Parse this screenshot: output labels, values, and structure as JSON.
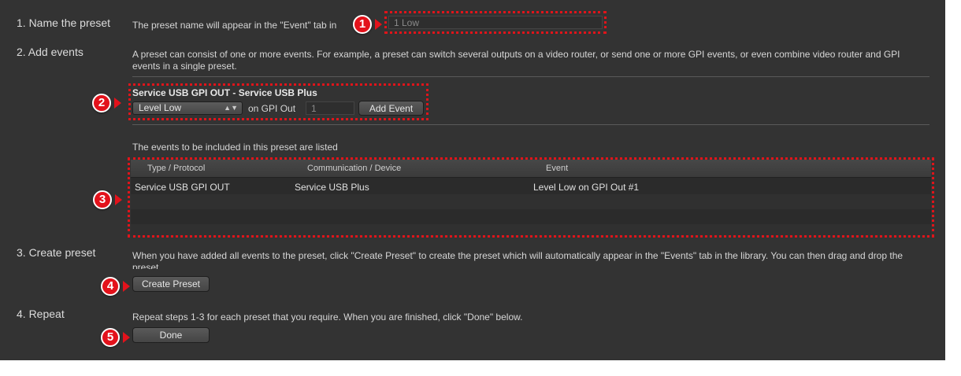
{
  "steps": {
    "name": "1. Name the preset",
    "add": "2. Add events",
    "create": "3. Create preset",
    "repeat": "4. Repeat"
  },
  "name_section": {
    "hint": "The preset name will appear in the \"Event\" tab in",
    "preset_name_value": "1 Low"
  },
  "add_section": {
    "description": "A preset can consist of one or more events. For example, a preset can switch several outputs on a video router, or send one or more GPI events, or even combine video router and GPI events in a single preset.",
    "device_title": "Service USB GPI OUT - Service USB Plus",
    "level_select": "Level Low",
    "on_gpi_label": "on GPI Out",
    "gpi_out_value": "1",
    "add_event_label": "Add Event",
    "events_listed": "The events to be included in this preset are listed"
  },
  "table": {
    "headers": [
      "Type / Protocol",
      "Communication / Device",
      "Event"
    ],
    "rows": [
      [
        "Service USB GPI OUT",
        "Service USB Plus",
        "Level Low on GPI Out #1"
      ]
    ]
  },
  "create_section": {
    "description": "When you have added all events to the preset, click \"Create Preset\" to create the preset which will automatically appear in the \"Events\" tab in the library. You can then drag and drop the preset",
    "create_button": "Create Preset"
  },
  "repeat_section": {
    "description": "Repeat steps 1-3 for each preset that you require. When you are finished, click \"Done\" below.",
    "done_button": "Done"
  },
  "badges": [
    "1",
    "2",
    "3",
    "4",
    "5"
  ],
  "colors": {
    "panel": "#333333",
    "callout_red": "#e3121b"
  }
}
